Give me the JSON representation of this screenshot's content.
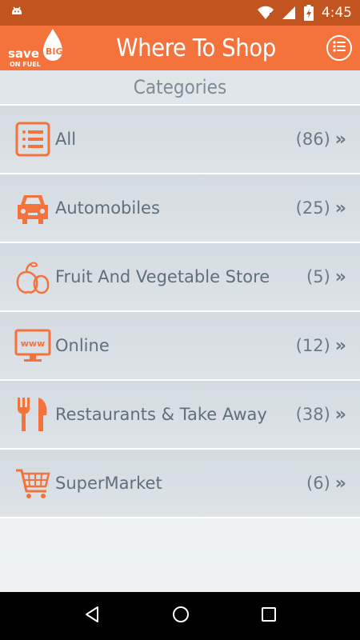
{
  "status_bar": {
    "time": "4:45",
    "icons": [
      "android-debug-icon",
      "wifi-icon",
      "signal-icon",
      "battery-charging-icon"
    ]
  },
  "app_bar": {
    "logo_text_top": "save",
    "logo_text_badge": "BIG",
    "logo_text_bottom": "ON FUEL",
    "title": "Where To Shop",
    "menu_icon": "list-menu-icon"
  },
  "section": {
    "title": "Categories"
  },
  "categories": [
    {
      "label": "All",
      "count": "(86)",
      "icon": "list-icon"
    },
    {
      "label": "Automobiles",
      "count": "(25)",
      "icon": "car-icon"
    },
    {
      "label": "Fruit And Vegetable Store",
      "count": "(5)",
      "icon": "fruit-icon"
    },
    {
      "label": "Online",
      "count": "(12)",
      "icon": "www-monitor-icon"
    },
    {
      "label": "Restaurants & Take Away",
      "count": "(38)",
      "icon": "fork-knife-icon"
    },
    {
      "label": "SuperMarket",
      "count": "(6)",
      "icon": "shopping-cart-icon"
    }
  ],
  "chevron": "»",
  "nav_bar": {
    "icons": [
      "back-icon",
      "home-icon",
      "recents-icon"
    ]
  },
  "colors": {
    "accent": "#f4733d",
    "status_bar": "#c2551f",
    "text": "#5f6f7c"
  }
}
